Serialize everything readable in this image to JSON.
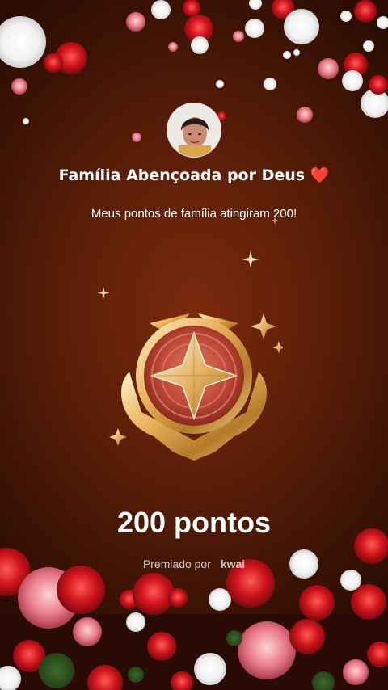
{
  "header": {
    "title": "Família Abençoada por Deus ❤️",
    "message": "Meus pontos de família atingiram 200!"
  },
  "badge": {
    "icon": "star-medal-icon"
  },
  "points_label": "200 pontos",
  "awarded_by": {
    "prefix": "Premiado por",
    "brand": "kwai"
  },
  "colors": {
    "background": "#5a1e08",
    "gold": "#e8b15a",
    "medal_red": "#c24a3a"
  }
}
